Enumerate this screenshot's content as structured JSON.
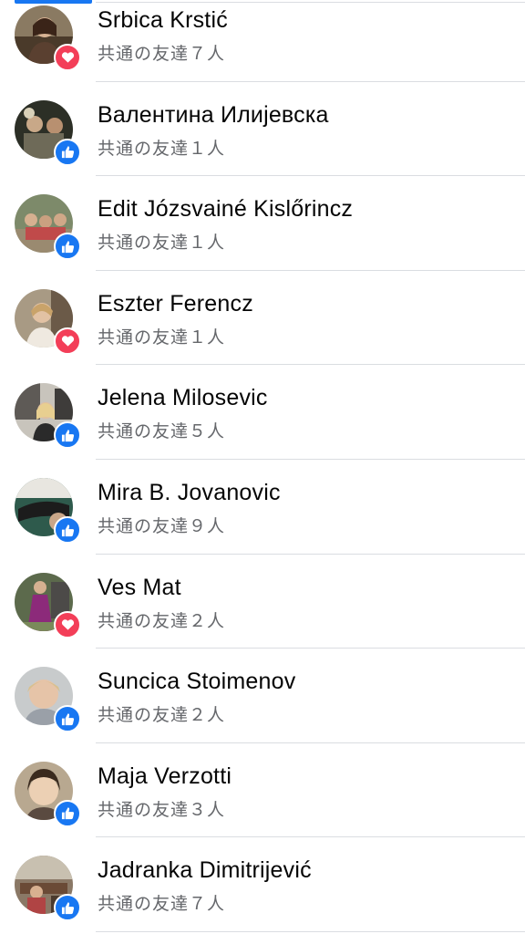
{
  "reactions_list": {
    "accent_color": "#1877f2",
    "like_color": "#1877f2",
    "love_color": "#f33e58",
    "items": [
      {
        "name": "Srbica Krstić",
        "mutual": "共通の友達７人",
        "reaction": "love-icon"
      },
      {
        "name": "Валентина Илијевска",
        "mutual": "共通の友達１人",
        "reaction": "like-icon"
      },
      {
        "name": "Edit Józsvainé Kislőrincz",
        "mutual": "共通の友達１人",
        "reaction": "like-icon"
      },
      {
        "name": "Eszter Ferencz",
        "mutual": "共通の友達１人",
        "reaction": "love-icon"
      },
      {
        "name": "Jelena Milosevic",
        "mutual": "共通の友達５人",
        "reaction": "like-icon"
      },
      {
        "name": "Mira B. Jovanovic",
        "mutual": "共通の友達９人",
        "reaction": "like-icon"
      },
      {
        "name": "Ves Mat",
        "mutual": "共通の友達２人",
        "reaction": "love-icon"
      },
      {
        "name": "Suncica Stoimenov",
        "mutual": "共通の友達２人",
        "reaction": "like-icon"
      },
      {
        "name": "Maja Verzotti",
        "mutual": "共通の友達３人",
        "reaction": "like-icon"
      },
      {
        "name": "Jadranka Dimitrijević",
        "mutual": "共通の友達７人",
        "reaction": "like-icon"
      }
    ]
  }
}
